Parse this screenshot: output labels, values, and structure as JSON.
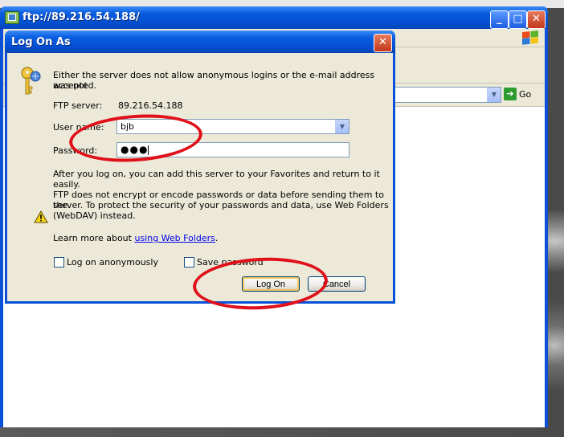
{
  "explorer": {
    "title": "ftp://89.216.54.188/",
    "go_label": "Go",
    "window_buttons": {
      "minimize": "_",
      "maximize": "□",
      "close": "✕"
    }
  },
  "dialog": {
    "title": "Log On As",
    "close_glyph": "✕",
    "intro_line1": "Either the server does not allow anonymous logins or the e-mail address was not",
    "intro_line2": "accepted.",
    "ftp_server_label": "FTP server:",
    "ftp_server_value": "89.216.54.188",
    "username_label": "User name:",
    "username_value": "bjb",
    "password_label": "Password:",
    "password_dots": "●●●",
    "favorites_note": "After you log on, you can add this server to your Favorites and return to it easily.",
    "warning_line1": "FTP does not encrypt or encode passwords or data before sending them to the",
    "warning_line2": "server.  To protect the security of your passwords and data, use Web Folders",
    "warning_line3": "(WebDAV) instead.",
    "learn_more_prefix": "Learn more about ",
    "learn_more_link": "using Web Folders",
    "learn_more_suffix": ".",
    "anonymous_label": "Log on anonymously",
    "save_password_label": "Save password",
    "logon_button": "Log On",
    "cancel_button": "Cancel"
  },
  "colors": {
    "title_bar": "#0a5ee0",
    "dialog_face": "#ece9d8",
    "annotation": "#e0101a",
    "link": "#0000ee"
  },
  "icons": [
    "ftp-folder-icon",
    "windows-logo-icon",
    "key-icon",
    "warning-icon",
    "go-arrow-icon",
    "combo-arrow-icon"
  ]
}
